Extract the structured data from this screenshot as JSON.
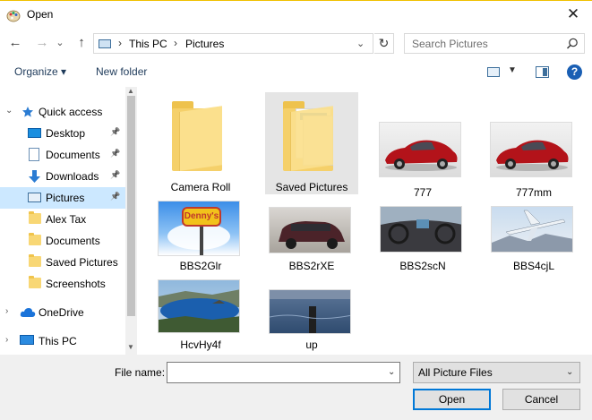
{
  "window": {
    "title": "Open",
    "close_glyph": "✕"
  },
  "nav": {
    "back_glyph": "←",
    "forward_glyph": "→",
    "recent_glyph": "⌄",
    "up_glyph": "↑"
  },
  "address": {
    "segments": [
      "This PC",
      "Pictures"
    ],
    "separator": "›",
    "dropdown_glyph": "⌄",
    "refresh_glyph": "↻"
  },
  "search": {
    "placeholder": "Search Pictures"
  },
  "toolbar": {
    "organize_label": "Organize ▾",
    "new_folder_label": "New folder",
    "view_dropdown_glyph": "▼",
    "help_label": "?"
  },
  "sidebar": {
    "items": [
      {
        "label": "Quick access",
        "icon": "star-icon",
        "expander": "⌄"
      },
      {
        "label": "Desktop",
        "icon": "desktop-icon",
        "pinned": true
      },
      {
        "label": "Documents",
        "icon": "documents-icon",
        "pinned": true
      },
      {
        "label": "Downloads",
        "icon": "download-icon",
        "pinned": true
      },
      {
        "label": "Pictures",
        "icon": "pictures-icon",
        "pinned": true,
        "selected": true
      },
      {
        "label": "Alex Tax",
        "icon": "folder-icon"
      },
      {
        "label": "Documents",
        "icon": "folder-icon"
      },
      {
        "label": "Saved Pictures",
        "icon": "folder-icon"
      },
      {
        "label": "Screenshots",
        "icon": "folder-icon"
      },
      {
        "label": "OneDrive",
        "icon": "cloud-icon",
        "expander": "›"
      },
      {
        "label": "This PC",
        "icon": "computer-icon",
        "expander": "›"
      }
    ],
    "pin_glyph": "📌",
    "scroll_up_glyph": "▲",
    "scroll_down_glyph": "▼"
  },
  "files": [
    {
      "name": "Camera Roll",
      "kind": "folder"
    },
    {
      "name": "Saved Pictures",
      "kind": "folder",
      "hovered": true
    },
    {
      "name": "777",
      "kind": "image-red-car"
    },
    {
      "name": "777mm",
      "kind": "image-red-car"
    },
    {
      "name": "BBS2Glr",
      "kind": "image-dennys-sign",
      "sign_text": "Denny's"
    },
    {
      "name": "BBS2rXE",
      "kind": "image-suv"
    },
    {
      "name": "BBS2scN",
      "kind": "image-car-interior"
    },
    {
      "name": "BBS4cjL",
      "kind": "image-airplane"
    },
    {
      "name": "HcvHy4f",
      "kind": "image-lake"
    },
    {
      "name": "up",
      "kind": "image-water"
    }
  ],
  "bottom": {
    "file_name_label": "File name:",
    "file_name_value": "",
    "file_name_dropdown_glyph": "⌄",
    "file_type_value": "All Picture Files",
    "file_type_dropdown_glyph": "⌄",
    "open_label": "Open",
    "cancel_label": "Cancel"
  },
  "colors": {
    "selection": "#cce8ff",
    "hover": "#e5e5e5",
    "accent": "#0078d7"
  }
}
